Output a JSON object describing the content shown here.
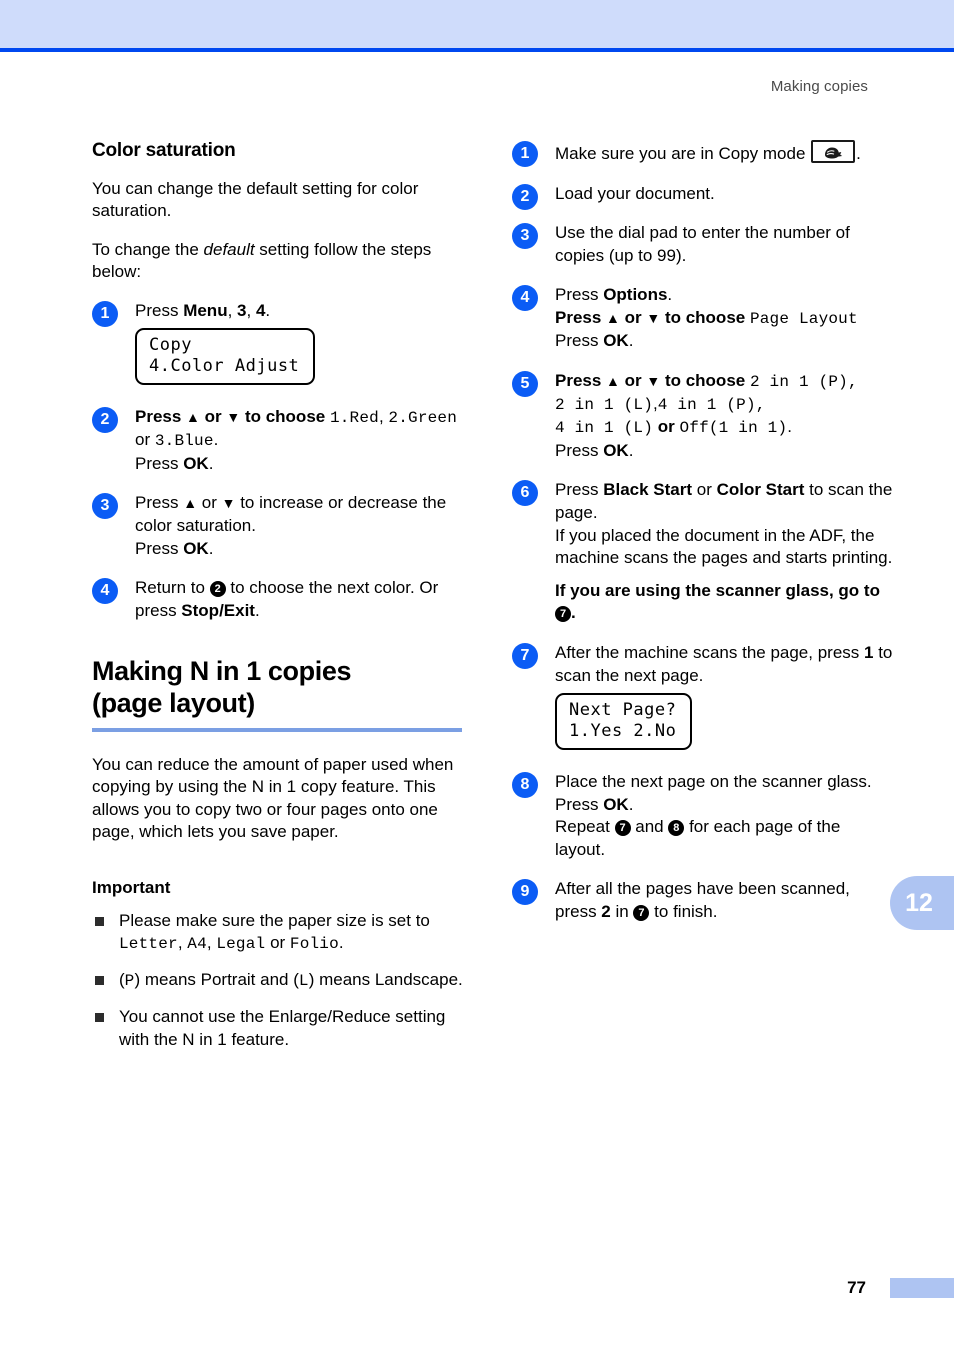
{
  "page": {
    "running_head": "Making copies",
    "folio": "77",
    "chapter_tab": "12"
  },
  "left_column": {
    "section_heading": "Color saturation",
    "intro_paragraph": "You can change the default setting for color saturation.",
    "instruction_lead_1": "To change the ",
    "instruction_lead_italic": "default",
    "instruction_lead_2": " setting follow the steps below:",
    "steps": [
      {
        "number": "1",
        "line1_a": "Press ",
        "line1_bold1": "Menu",
        "line1_b": ", ",
        "line1_bold2": "3",
        "line1_c": ", ",
        "line1_bold3": "4",
        "line1_d": ".",
        "lcd": {
          "line1": "Copy",
          "line2": "4.Color Adjust"
        }
      },
      {
        "number": "2",
        "line1_a": "Press ",
        "line1_up": "▲",
        "line1_b": " or ",
        "line1_down": "▼",
        "line1_c": " to choose ",
        "line1_mono1": "1.Red",
        "line1_d": ", ",
        "line1_mono2": "2.Green",
        "line2_a": "or ",
        "line2_mono": "3.Blue",
        "line2_b": ".",
        "line3_a": "Press ",
        "line3_bold": "OK",
        "line3_b": "."
      },
      {
        "number": "3",
        "line1_a": "Press ",
        "line1_up": "▲",
        "line1_b": " or ",
        "line1_down": "▼",
        "line1_c": " to increase or decrease the color saturation.",
        "line2_a": "Press ",
        "line2_bold": "OK",
        "line2_b": "."
      },
      {
        "number": "4",
        "line1_a": "Return to ",
        "line1_ref": "2",
        "line1_b": " to choose the next color. Or press ",
        "line1_bold": "Stop/Exit",
        "line1_c": "."
      }
    ],
    "chapter_heading_line1": "Making N in 1 copies",
    "chapter_heading_line2": "(page layout)",
    "chapter_intro": "You can reduce the amount of paper used when copying by using the N in 1 copy feature. This allows you to copy two or four pages onto one page, which lets you save paper.",
    "important_heading": "Important",
    "important_bullets": [
      {
        "a": "Please make sure the paper size is set to ",
        "mono1": "Letter",
        "b": ", ",
        "mono2": "A4",
        "c": ", ",
        "mono3": "Legal",
        "d": " or ",
        "mono4": "Folio",
        "e": "."
      },
      {
        "a": "(",
        "mono1": "P",
        "b": ") means Portrait and (",
        "mono2": "L",
        "c": ") means Landscape."
      },
      {
        "a": "You cannot use the Enlarge/Reduce setting with the N in 1 feature."
      }
    ]
  },
  "right_column": {
    "steps": [
      {
        "number": "1",
        "line1_a": "Make sure you are in Copy mode ",
        "icon": "copy-mode-key-icon",
        "line1_b": "."
      },
      {
        "number": "2",
        "line1_a": "Load your document."
      },
      {
        "number": "3",
        "line1_a": "Use the dial pad to enter the number of copies (up to 99)."
      },
      {
        "number": "4",
        "line1_a": "Press ",
        "line1_bold": "Options",
        "line1_b": ".",
        "line2_a": "Press ",
        "line2_up": "▲",
        "line2_b": " or ",
        "line2_down": "▼",
        "line2_c": " to choose ",
        "line2_mono": "Page Layout",
        "line3_a": "Press ",
        "line3_bold": "OK",
        "line3_b": "."
      },
      {
        "number": "5",
        "line1_a": "Press ",
        "line1_up": "▲",
        "line1_b": " or ",
        "line1_down": "▼",
        "line1_c": " to choose ",
        "line1_mono": "2 in 1 (P),",
        "line2_mono1": "2 in 1 (L)",
        "line2_sep": ",",
        "line2_mono2": "4 in 1 (P),",
        "line3_mono1": "4 in 1 (L)",
        "line3_or": " or ",
        "line3_mono2": "Off(1 in 1)",
        "line3_end": ".",
        "line4_a": "Press ",
        "line4_bold": "OK",
        "line4_b": "."
      },
      {
        "number": "6",
        "line1_a": "Press ",
        "line1_bold1": "Black Start",
        "line1_b": " or ",
        "line1_bold2": "Color Start",
        "line1_c": " to scan the page.",
        "line2": "If you placed the document in the ADF, the machine scans the pages and starts printing.",
        "line3_bold_a": "If you are using the scanner glass, go to ",
        "line3_ref": "7",
        "line3_bold_b": "."
      },
      {
        "number": "7",
        "line1_a": "After the machine scans the page, press ",
        "line1_bold": "1",
        "line1_b": " to scan the next page.",
        "lcd": {
          "line1": "Next Page?",
          "line2": "1.Yes 2.No"
        }
      },
      {
        "number": "8",
        "line1_a": "Place the next page on the scanner glass.",
        "line2_a": "Press ",
        "line2_bold": "OK",
        "line2_b": ".",
        "line3_a": "Repeat ",
        "line3_ref1": "7",
        "line3_b": " and ",
        "line3_ref2": "8",
        "line3_c": " for each page of the layout."
      },
      {
        "number": "9",
        "line1_a": "After all the pages have been scanned, press ",
        "line1_bold": "2",
        "line1_b": " in ",
        "line1_ref": "7",
        "line1_c": " to finish."
      }
    ]
  },
  "colors": {
    "band": "#cfdcfb",
    "rule": "#0048f0",
    "badge": "#0b5cf5",
    "heading_underline": "#7b9fe3",
    "tab": "#aec4f2"
  }
}
